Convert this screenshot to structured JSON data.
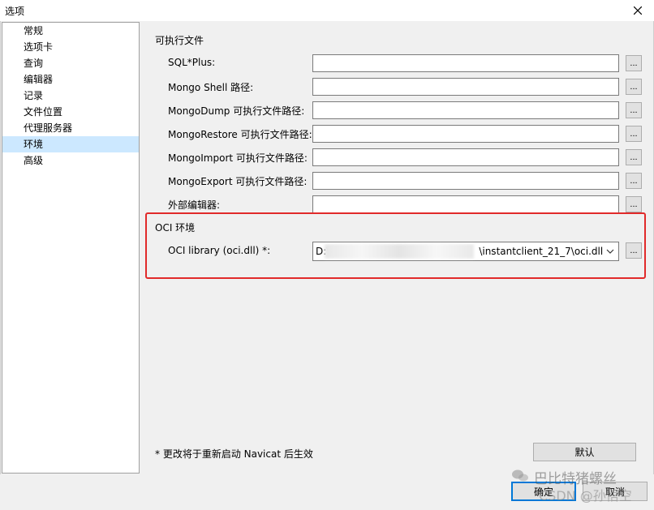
{
  "window": {
    "title": "选项"
  },
  "sidebar": {
    "items": [
      {
        "label": "常规"
      },
      {
        "label": "选项卡"
      },
      {
        "label": "查询"
      },
      {
        "label": "编辑器"
      },
      {
        "label": "记录"
      },
      {
        "label": "文件位置"
      },
      {
        "label": "代理服务器"
      },
      {
        "label": "环境",
        "selected": true
      },
      {
        "label": "高级"
      }
    ]
  },
  "executables": {
    "section_label": "可执行文件",
    "rows": [
      {
        "label": "SQL*Plus:",
        "value": ""
      },
      {
        "label": "Mongo Shell 路径:",
        "value": ""
      },
      {
        "label": "MongoDump 可执行文件路径:",
        "value": ""
      },
      {
        "label": "MongoRestore 可执行文件路径:",
        "value": ""
      },
      {
        "label": "MongoImport 可执行文件路径:",
        "value": ""
      },
      {
        "label": "MongoExport 可执行文件路径:",
        "value": ""
      },
      {
        "label": "外部编辑器:",
        "value": ""
      }
    ],
    "browse_label": "..."
  },
  "oci": {
    "section_label": "OCI 环境",
    "library_label": "OCI library (oci.dll) *:",
    "value_prefix": "D:\\",
    "value_suffix": "\\instantclient_21_7\\oci.dll",
    "browse_label": "...",
    "highlight_color": "#e12a2a"
  },
  "footer": {
    "note": "* 更改将于重新启动 Navicat 后生效",
    "default_button": "默认",
    "ok_button": "确定",
    "cancel_button": "取消"
  },
  "watermark": {
    "line1": "巴比特猪螺丝",
    "line2": "CSDN @孙悟空"
  },
  "colors": {
    "selection": "#cce8ff",
    "dialog_bg": "#f0f0f0",
    "focus_border": "#0078d7"
  }
}
